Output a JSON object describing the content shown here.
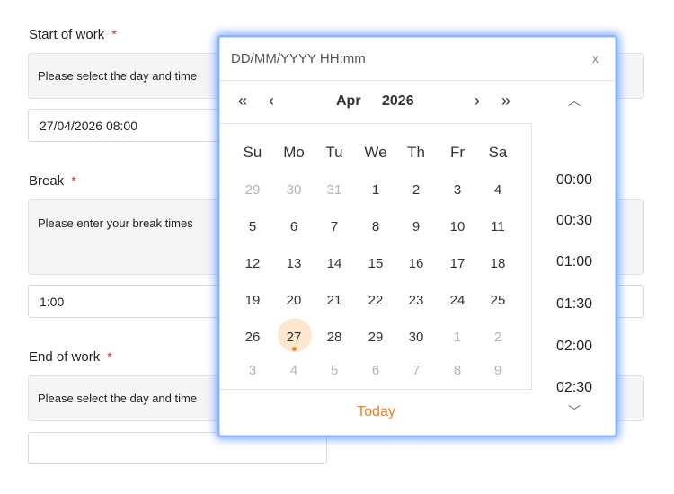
{
  "form": {
    "start": {
      "label": "Start of work",
      "required_mark": "*",
      "hint": "Please select the day and time",
      "value": "27/04/2026 08:00"
    },
    "break": {
      "label": "Break",
      "required_mark": "*",
      "hint": "Please enter your break times",
      "value": "1:00"
    },
    "end": {
      "label": "End of work",
      "required_mark": "*",
      "hint": "Please select the day and time",
      "value": ""
    }
  },
  "picker": {
    "placeholder": "DD/MM/YYYY HH:mm",
    "close_label": "x",
    "prev_year_icon": "«",
    "prev_month_icon": "‹",
    "next_month_icon": "›",
    "next_year_icon": "»",
    "month": "Apr",
    "year": "2026",
    "weekdays": [
      "Su",
      "Mo",
      "Tu",
      "We",
      "Th",
      "Fr",
      "Sa"
    ],
    "weeks": [
      [
        "29",
        "30",
        "31",
        "1",
        "2",
        "3",
        "4"
      ],
      [
        "5",
        "6",
        "7",
        "8",
        "9",
        "10",
        "11"
      ],
      [
        "12",
        "13",
        "14",
        "15",
        "16",
        "17",
        "18"
      ],
      [
        "19",
        "20",
        "21",
        "22",
        "23",
        "24",
        "25"
      ],
      [
        "26",
        "27",
        "28",
        "29",
        "30",
        "1",
        "2"
      ],
      [
        "3",
        "4",
        "5",
        "6",
        "7",
        "8",
        "9"
      ]
    ],
    "today_button": "Today",
    "time_up_icon": "︿",
    "time_down_icon": "﹀",
    "times": [
      "00:00",
      "00:30",
      "01:00",
      "01:30",
      "02:00",
      "02:30"
    ],
    "colors": {
      "accent": "#f07a20",
      "selected_bg": "#fde8cf",
      "glow": "#488aff"
    }
  }
}
